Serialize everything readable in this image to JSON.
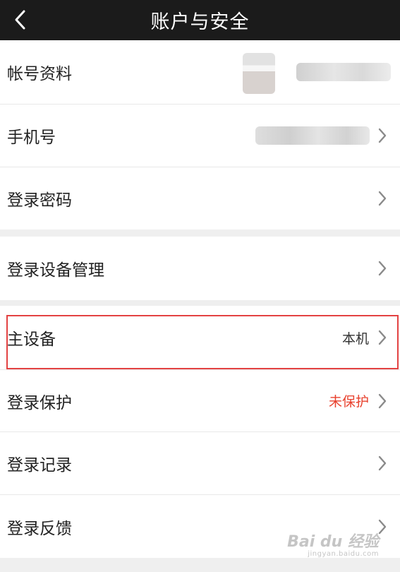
{
  "header": {
    "title": "账户与安全",
    "back_icon": "chevron-left-icon"
  },
  "rows": [
    {
      "label": "帐号资料",
      "value": ""
    },
    {
      "label": "手机号",
      "value": ""
    },
    {
      "label": "登录密码",
      "value": ""
    },
    {
      "label": "登录设备管理",
      "value": ""
    },
    {
      "label": "主设备",
      "value": "本机"
    },
    {
      "label": "登录保护",
      "value": "未保护"
    },
    {
      "label": "登录记录",
      "value": ""
    },
    {
      "label": "登录反馈",
      "value": ""
    }
  ],
  "colors": {
    "header_bg": "#1b1b1b",
    "warning_text": "#e8402d",
    "highlight_border": "#e34242"
  },
  "watermark": {
    "brand": "Bai du 经验",
    "url": "jingyan.baidu.com"
  }
}
